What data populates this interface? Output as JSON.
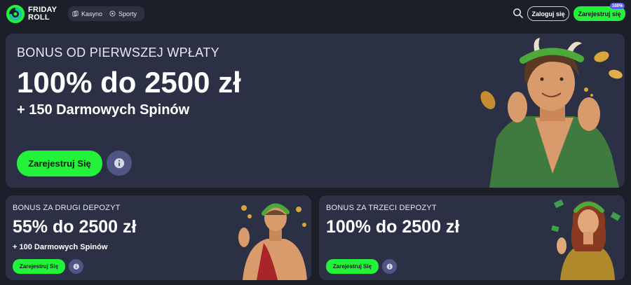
{
  "header": {
    "logo_line1": "FRIDAY",
    "logo_line2": "ROLL",
    "nav": [
      {
        "label": "Kasyno",
        "icon": "cards-icon"
      },
      {
        "label": "Sporty",
        "icon": "ball-icon"
      }
    ],
    "login_label": "Zaloguj się",
    "register_label": "Zarejestruj się",
    "register_badge": "100%"
  },
  "hero": {
    "kicker": "BONUS OD PIERWSZEJ WPŁATY",
    "amount": "100% do 2500 zł",
    "spins": "+ 150 Darmowych Spinów",
    "button_label": "Zarejestruj Się"
  },
  "offers": [
    {
      "kicker": "BONUS ZA DRUGI DEPOZYT",
      "amount": "55% do 2500 zł",
      "spins": "+ 100 Darmowych Spinów",
      "button_label": "Zarejestruj Się"
    },
    {
      "kicker": "BONUS ZA TRZECI DEPOZYT",
      "amount": "100% do 2500 zł",
      "button_label": "Zarejestruj Się"
    }
  ],
  "colors": {
    "background": "#1c1f2a",
    "card": "#2c3045",
    "accent_green": "#22f23a",
    "info_button": "#4f5685",
    "badge": "#5a5ff0"
  }
}
